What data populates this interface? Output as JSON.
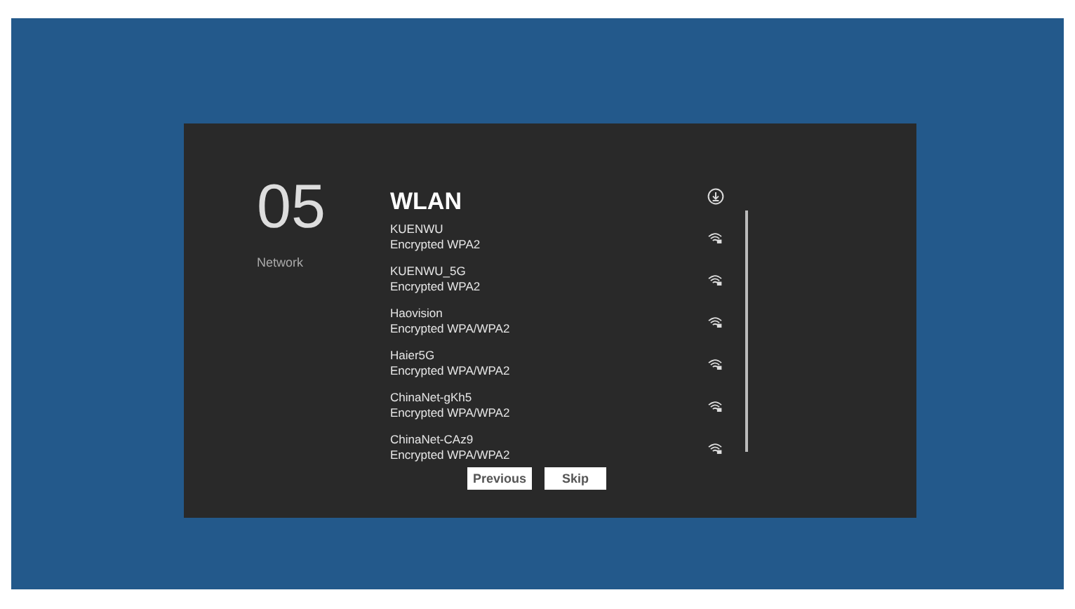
{
  "step": {
    "number": "05",
    "label": "Network"
  },
  "wlan": {
    "title": "WLAN",
    "networks": [
      {
        "name": "KUENWU",
        "security": "Encrypted WPA2"
      },
      {
        "name": "KUENWU_5G",
        "security": "Encrypted WPA2"
      },
      {
        "name": "Haovision",
        "security": "Encrypted WPA/WPA2"
      },
      {
        "name": "Haier5G",
        "security": "Encrypted WPA/WPA2"
      },
      {
        "name": "ChinaNet-gKh5",
        "security": "Encrypted WPA/WPA2"
      },
      {
        "name": "ChinaNet-CAz9",
        "security": "Encrypted WPA/WPA2"
      }
    ]
  },
  "buttons": [
    "Previous",
    "Skip"
  ]
}
